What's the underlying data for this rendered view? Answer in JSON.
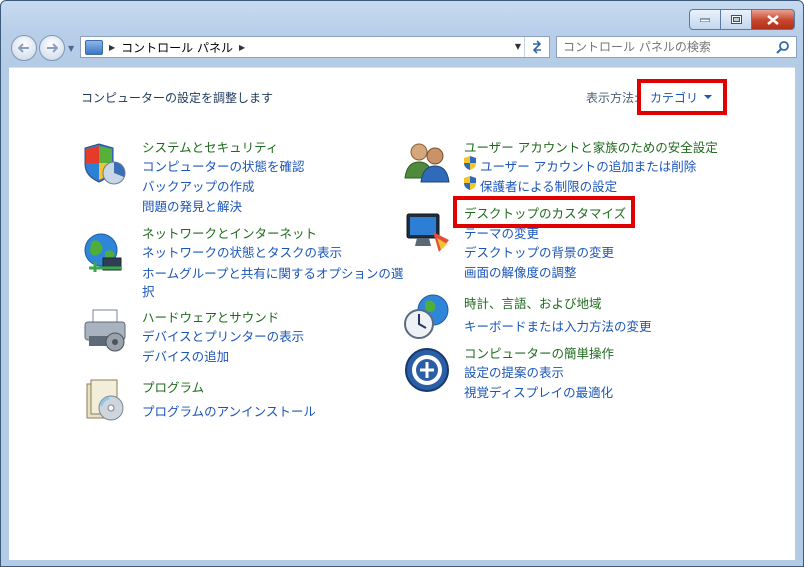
{
  "window": {
    "title": "コントロール パネル"
  },
  "address": {
    "crumbs": [
      "コントロール パネル"
    ]
  },
  "search": {
    "placeholder": "コントロール パネルの検索"
  },
  "header": {
    "subtitle": "コンピューターの設定を調整します",
    "view_label": "表示方法:",
    "view_value": "カテゴリ"
  },
  "categories_left": [
    {
      "title": "システムとセキュリティ",
      "icon": "shield-icon",
      "links": [
        "コンピューターの状態を確認",
        "バックアップの作成",
        "問題の発見と解決"
      ]
    },
    {
      "title": "ネットワークとインターネット",
      "icon": "network-globe-icon",
      "links": [
        "ネットワークの状態とタスクの表示",
        "ホームグループと共有に関するオプションの選",
        "択"
      ]
    },
    {
      "title": "ハードウェアとサウンド",
      "icon": "printer-icon",
      "links": [
        "デバイスとプリンターの表示",
        "デバイスの追加"
      ]
    },
    {
      "title": "プログラム",
      "icon": "programs-icon",
      "links": [
        "プログラムのアンインストール"
      ]
    }
  ],
  "categories_right": [
    {
      "title": "ユーザー アカウントと家族のための安全設定",
      "icon": "users-icon",
      "links": [
        "ユーザー アカウントの追加または削除",
        "保護者による制限の設定"
      ]
    },
    {
      "title": "デスクトップのカスタマイズ",
      "icon": "display-icon",
      "links": [
        "テーマの変更",
        "デスクトップの背景の変更",
        "画面の解像度の調整"
      ]
    },
    {
      "title": "時計、言語、および地域",
      "icon": "clock-globe-icon",
      "links": [
        "キーボードまたは入力方法の変更"
      ]
    },
    {
      "title": "コンピューターの簡単操作",
      "icon": "ease-of-access-icon",
      "links": [
        "設定の提案の表示",
        "視覚ディスプレイの最適化"
      ]
    }
  ],
  "colors": {
    "highlight": "#e00000",
    "link": "#1a55b8",
    "category": "#1e6b1e"
  }
}
